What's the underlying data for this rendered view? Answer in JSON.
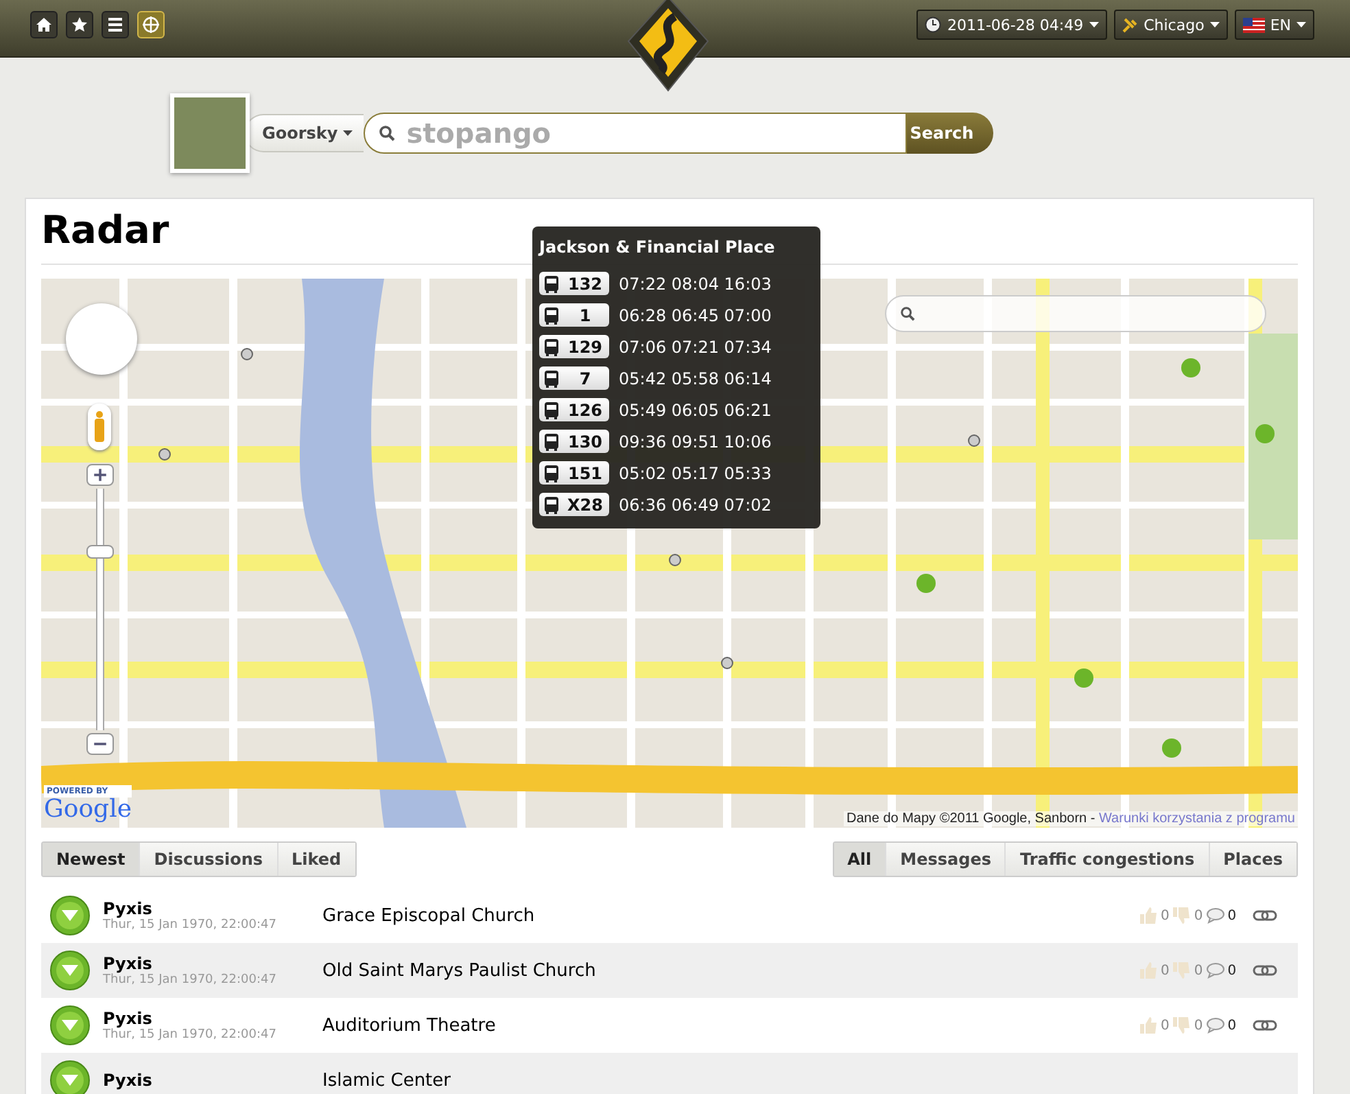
{
  "top_bar": {
    "nav_icons": [
      {
        "kind": "home",
        "selected": false
      },
      {
        "kind": "star",
        "selected": false
      },
      {
        "kind": "list",
        "selected": false
      },
      {
        "kind": "radar",
        "selected": true
      }
    ],
    "datetime": "2011-06-28 04:49",
    "city": "Chicago",
    "language": "EN"
  },
  "search": {
    "user": "Goorsky",
    "placeholder": "stopango",
    "button": "Search"
  },
  "page_title": "Radar",
  "map": {
    "zoom_slider": {
      "level": 0.75
    },
    "powered_by": "POWERED BY",
    "logo": "Google",
    "attribution": "Dane do Mapy ©2011 Google, Sanborn -",
    "terms_link": "Warunki korzystania z programu",
    "tooltip": {
      "title": "Jackson & Financial Place",
      "routes": [
        {
          "route": "132",
          "times": "07:22 08:04 16:03"
        },
        {
          "route": "1",
          "times": "06:28 06:45 07:00"
        },
        {
          "route": "129",
          "times": "07:06 07:21 07:34"
        },
        {
          "route": "7",
          "times": "05:42 05:58 06:14"
        },
        {
          "route": "126",
          "times": "05:49 06:05 06:21"
        },
        {
          "route": "130",
          "times": "09:36 09:51 10:06"
        },
        {
          "route": "151",
          "times": "05:02 05:17 05:33"
        },
        {
          "route": "X28",
          "times": "06:36 06:49 07:02"
        }
      ]
    }
  },
  "tabs": [
    {
      "label": "Newest",
      "selected": true
    },
    {
      "label": "Discussions",
      "selected": false
    },
    {
      "label": "Liked",
      "selected": false
    }
  ],
  "filters": [
    {
      "label": "All",
      "selected": true
    },
    {
      "label": "Messages",
      "selected": false
    },
    {
      "label": "Traffic congestions",
      "selected": false
    },
    {
      "label": "Places",
      "selected": false
    }
  ],
  "feed": [
    {
      "user": "Pyxis",
      "date": "Thur, 15 Jan 1970, 22:00:47",
      "place": "Grace Episcopal Church",
      "likes": "0",
      "dislikes": "0",
      "comments": "0"
    },
    {
      "user": "Pyxis",
      "date": "Thur, 15 Jan 1970, 22:00:47",
      "place": "Old Saint Marys Paulist Church",
      "likes": "0",
      "dislikes": "0",
      "comments": "0"
    },
    {
      "user": "Pyxis",
      "date": "Thur, 15 Jan 1970, 22:00:47",
      "place": "Auditorium Theatre",
      "likes": "0",
      "dislikes": "0",
      "comments": "0"
    },
    {
      "user": "Pyxis",
      "place": "Islamic Center"
    }
  ]
}
